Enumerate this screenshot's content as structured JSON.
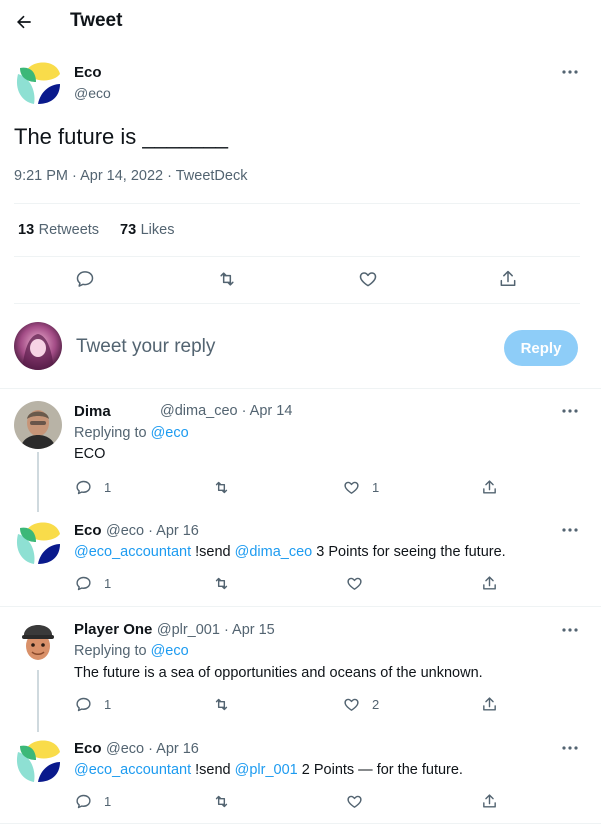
{
  "header": {
    "title": "Tweet"
  },
  "main_tweet": {
    "name": "Eco",
    "handle": "@eco",
    "text": "The future is _______",
    "meta": "9:21 PM · Apr 14, 2022 · TweetDeck",
    "retweets_count": "13",
    "retweets_label": "Retweets",
    "likes_count": "73",
    "likes_label": "Likes"
  },
  "reply_box": {
    "placeholder": "Tweet your reply",
    "button_label": "Reply"
  },
  "replies": [
    {
      "name": "Dima",
      "handle_date": "@dima_ceo · Apr 14",
      "replying_to_label": "Replying to",
      "replying_to_handle": "@eco",
      "text": "ECO",
      "reply_count": "1",
      "retweet_count": "",
      "like_count": "1"
    },
    {
      "name": "Eco",
      "handle_date": "@eco · Apr 16",
      "mention_1": "@eco_accountant",
      "text_1": " !send ",
      "mention_2": "@dima_ceo",
      "text_2": " 3 Points for seeing the future.",
      "reply_count": "1"
    },
    {
      "name": "Player One",
      "handle_date": "@plr_001 · Apr 15",
      "replying_to_label": "Replying to",
      "replying_to_handle": "@eco",
      "text": "The future is a sea of opportunities and oceans of the unknown.",
      "reply_count": "1",
      "like_count": "2"
    },
    {
      "name": "Eco",
      "handle_date": "@eco · Apr 16",
      "mention_1": "@eco_accountant",
      "text_1": " !send ",
      "mention_2": "@plr_001",
      "text_2": " 2 Points — for the future.",
      "reply_count": "1"
    }
  ],
  "icons": {
    "back": "arrow-left-icon",
    "more": "more-horizontal-icon",
    "reply": "comment-icon",
    "retweet": "retweet-icon",
    "like": "heart-icon",
    "share": "share-icon"
  },
  "colors": {
    "accent": "#1d9bf0",
    "reply_button": "#8ecdf8",
    "logo_yellow": "#f9dc4a",
    "logo_teal": "#8ee0d3",
    "logo_green": "#3cb878",
    "logo_navy": "#0a1a8c"
  }
}
